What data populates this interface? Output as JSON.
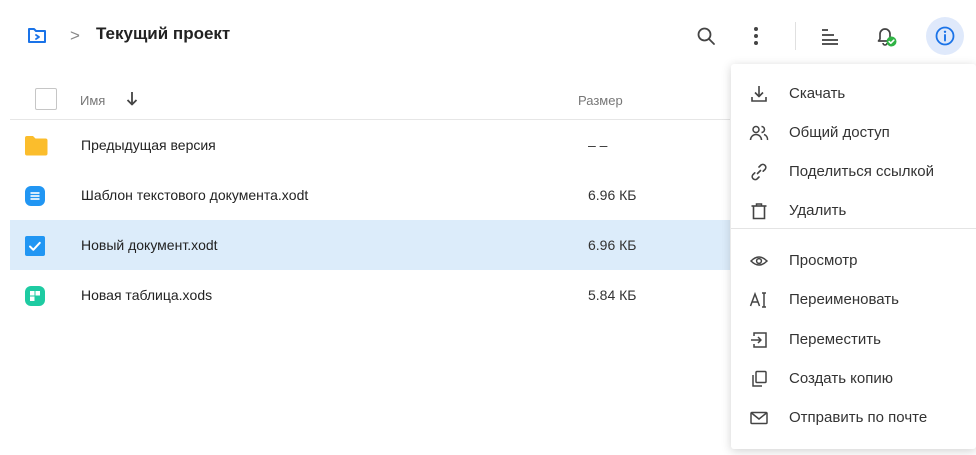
{
  "header": {
    "title": "Текущий проект",
    "separator": ">",
    "icons": [
      "folder-icon",
      "search-icon",
      "more-vertical-icon",
      "sort-list-icon",
      "notification-sync-icon",
      "info-icon"
    ],
    "colors": {
      "accent": "#1a73e8",
      "info_bg": "#dfe9fb",
      "sync_ok": "#2fb344"
    }
  },
  "list": {
    "columns": {
      "name": "Имя",
      "size": "Размер"
    },
    "rows": [
      {
        "name": "Предыдущая версия",
        "size": "– –",
        "icon": "folder-icon",
        "selected": false
      },
      {
        "name": "Шаблон текстового документа.xodt",
        "size": "6.96 КБ",
        "icon": "text-document-icon",
        "selected": false
      },
      {
        "name": "Новый документ.xodt",
        "size": "6.96 КБ",
        "icon": "checkbox-checked-icon",
        "selected": true
      },
      {
        "name": "Новая таблица.xods",
        "size": "5.84 КБ",
        "icon": "spreadsheet-icon",
        "selected": false
      }
    ],
    "colors": {
      "folder": "#fbbd2c",
      "text_doc": "#2196f3",
      "spreadsheet": "#1ecba2",
      "selected_bg": "#dcecfa"
    }
  },
  "context_menu": {
    "items": [
      {
        "label": "Скачать",
        "icon": "download-icon"
      },
      {
        "label": "Общий доступ",
        "icon": "shared-access-icon"
      },
      {
        "label": "Поделиться ссылкой",
        "icon": "link-icon"
      },
      {
        "label": "Удалить",
        "icon": "trash-icon"
      },
      {
        "label": "Просмотр",
        "icon": "eye-icon"
      },
      {
        "label": "Переименовать",
        "icon": "rename-icon"
      },
      {
        "label": "Переместить",
        "icon": "move-icon"
      },
      {
        "label": "Создать копию",
        "icon": "copy-icon"
      },
      {
        "label": "Отправить по почте",
        "icon": "mail-icon"
      }
    ]
  }
}
